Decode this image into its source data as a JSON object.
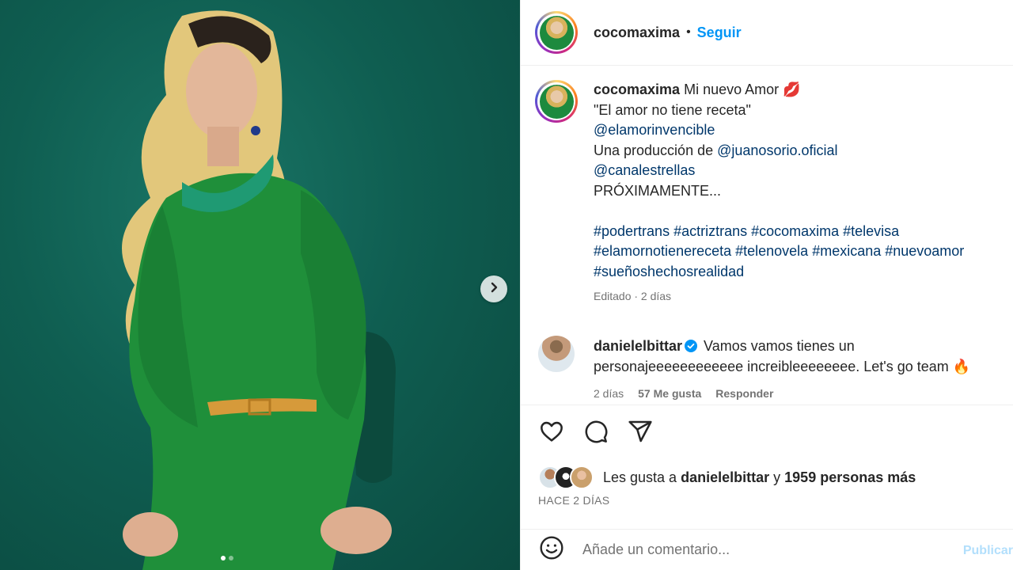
{
  "header": {
    "username": "cocomaxima",
    "separator": "•",
    "follow_label": "Seguir"
  },
  "caption": {
    "username": "cocomaxima",
    "line1": "Mi nuevo Amor",
    "emoji": "💋",
    "line2": "\"El amor no tiene receta\"",
    "mention1": "@elamorinvencible",
    "line3_prefix": "Una producción de",
    "mention2": "@juanosorio.oficial",
    "mention3": "@canalestrellas",
    "line4": "PRÓXIMAMENTE...",
    "hashtags_line1": "#podertrans #actriztrans #cocomaxima #televisa",
    "hashtags_line2": "#elamornotienereceta #telenovela #mexicana #nuevoamor",
    "hashtags_line3": "#sueñoshechosrealidad",
    "meta": "Editado · 2 días"
  },
  "comment": {
    "username": "danielelbittar",
    "text_line1": "Vamos vamos tienes un",
    "text_line2": "personajeeeeeeeeeeee increibleeeeeeee. Let's go team 🔥",
    "time": "2 días",
    "likes": "57 Me gusta",
    "reply": "Responder"
  },
  "likes": {
    "prefix": "Les gusta a",
    "user": "danielelbittar",
    "middle": "y",
    "count_text": "1959 personas más"
  },
  "posted": "HACE 2 DÍAS",
  "comment_input": {
    "placeholder": "Añade un comentario...",
    "post_label": "Publicar"
  },
  "colors": {
    "accent": "#0095f6",
    "link": "#00376b",
    "background_media": "#0f5a4c"
  },
  "icons": [
    "chevron-right-icon",
    "heart-icon",
    "comment-icon",
    "share-icon",
    "emoji-icon",
    "verified-icon"
  ]
}
